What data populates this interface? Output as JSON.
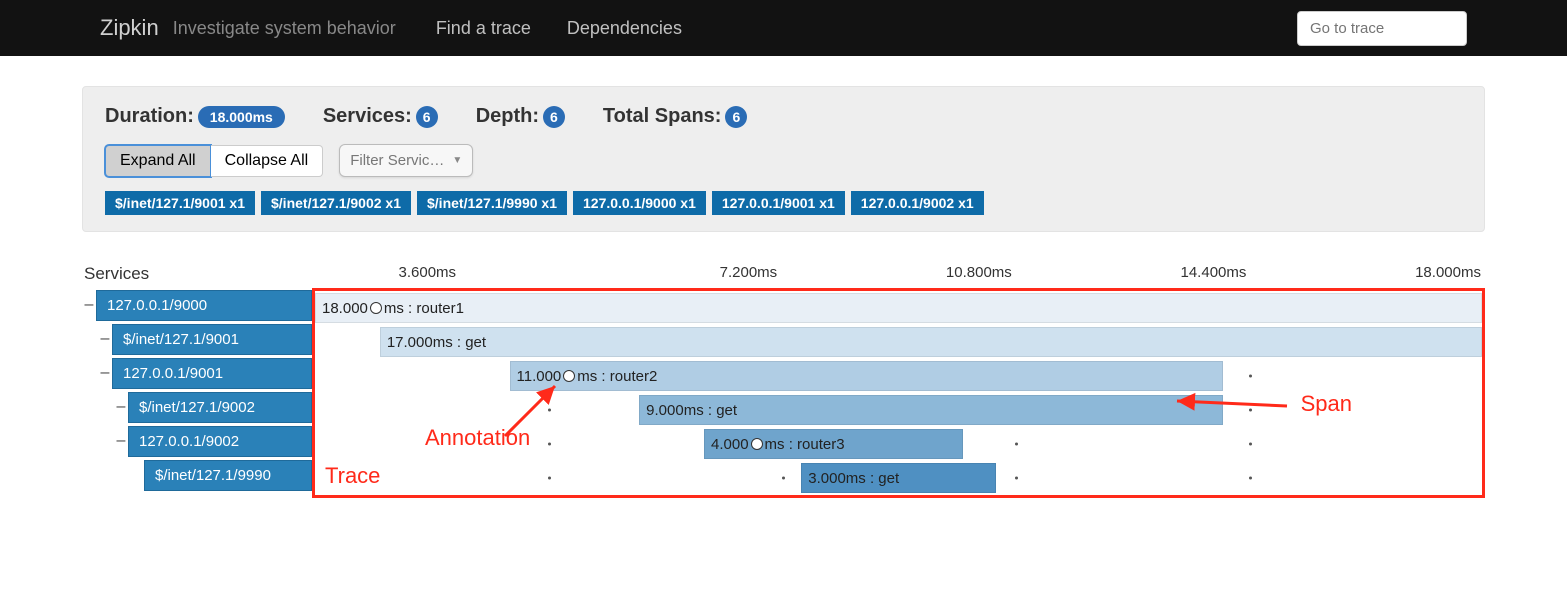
{
  "nav": {
    "brand": "Zipkin",
    "tagline": "Investigate system behavior",
    "link_find": "Find a trace",
    "link_deps": "Dependencies",
    "goto_placeholder": "Go to trace"
  },
  "summary": {
    "duration_label": "Duration:",
    "duration_value": "18.000ms",
    "services_label": "Services:",
    "services_value": "6",
    "depth_label": "Depth:",
    "depth_value": "6",
    "total_spans_label": "Total Spans:",
    "total_spans_value": "6"
  },
  "controls": {
    "expand_all": "Expand All",
    "collapse_all": "Collapse All",
    "filter_placeholder": "Filter Servic…"
  },
  "tags": [
    "$/inet/127.1/9001 x1",
    "$/inet/127.1/9002 x1",
    "$/inet/127.1/9990 x1",
    "127.0.0.1/9000 x1",
    "127.0.0.1/9001 x1",
    "127.0.0.1/9002 x1"
  ],
  "axis": {
    "services_header": "Services",
    "ticks": [
      "3.600ms",
      "7.200ms",
      "10.800ms",
      "14.400ms",
      "18.000ms"
    ]
  },
  "tree": [
    {
      "indent": 0,
      "toggle": "–",
      "label": "127.0.0.1/9000"
    },
    {
      "indent": 1,
      "toggle": "–",
      "label": "$/inet/127.1/9001"
    },
    {
      "indent": 1,
      "toggle": "–",
      "label": "127.0.0.1/9001"
    },
    {
      "indent": 2,
      "toggle": "–",
      "label": "$/inet/127.1/9002"
    },
    {
      "indent": 2,
      "toggle": "–",
      "label": "127.0.0.1/9002"
    },
    {
      "indent": 3,
      "toggle": "",
      "label": "$/inet/127.1/9990"
    }
  ],
  "chart_data": {
    "type": "bar",
    "xlabel": "",
    "ylabel": "",
    "xmax_ms": 18.0,
    "spans": [
      {
        "row": 0,
        "start_ms": 0.0,
        "dur_ms": 18.0,
        "label": "18.000ms : router1",
        "color": "#e8eff6",
        "dot": true
      },
      {
        "row": 1,
        "start_ms": 1.0,
        "dur_ms": 17.0,
        "label": "17.000ms : get",
        "color": "#cfe1ef",
        "dot": false
      },
      {
        "row": 2,
        "start_ms": 3.0,
        "dur_ms": 11.0,
        "label": "11.000ms : router2",
        "color": "#b0cde4",
        "dot": true
      },
      {
        "row": 3,
        "start_ms": 5.0,
        "dur_ms": 9.0,
        "label": "9.000ms : get",
        "color": "#8db8d8",
        "dot": false
      },
      {
        "row": 4,
        "start_ms": 6.0,
        "dur_ms": 4.0,
        "label": "4.000ms : router3",
        "color": "#6fa4cc",
        "dot": true
      },
      {
        "row": 5,
        "start_ms": 7.5,
        "dur_ms": 3.0,
        "label": "3.000ms : get",
        "color": "#4f90c2",
        "dot": false
      }
    ]
  },
  "callouts": {
    "annotation": "Annotation",
    "span": "Span",
    "trace": "Trace"
  }
}
